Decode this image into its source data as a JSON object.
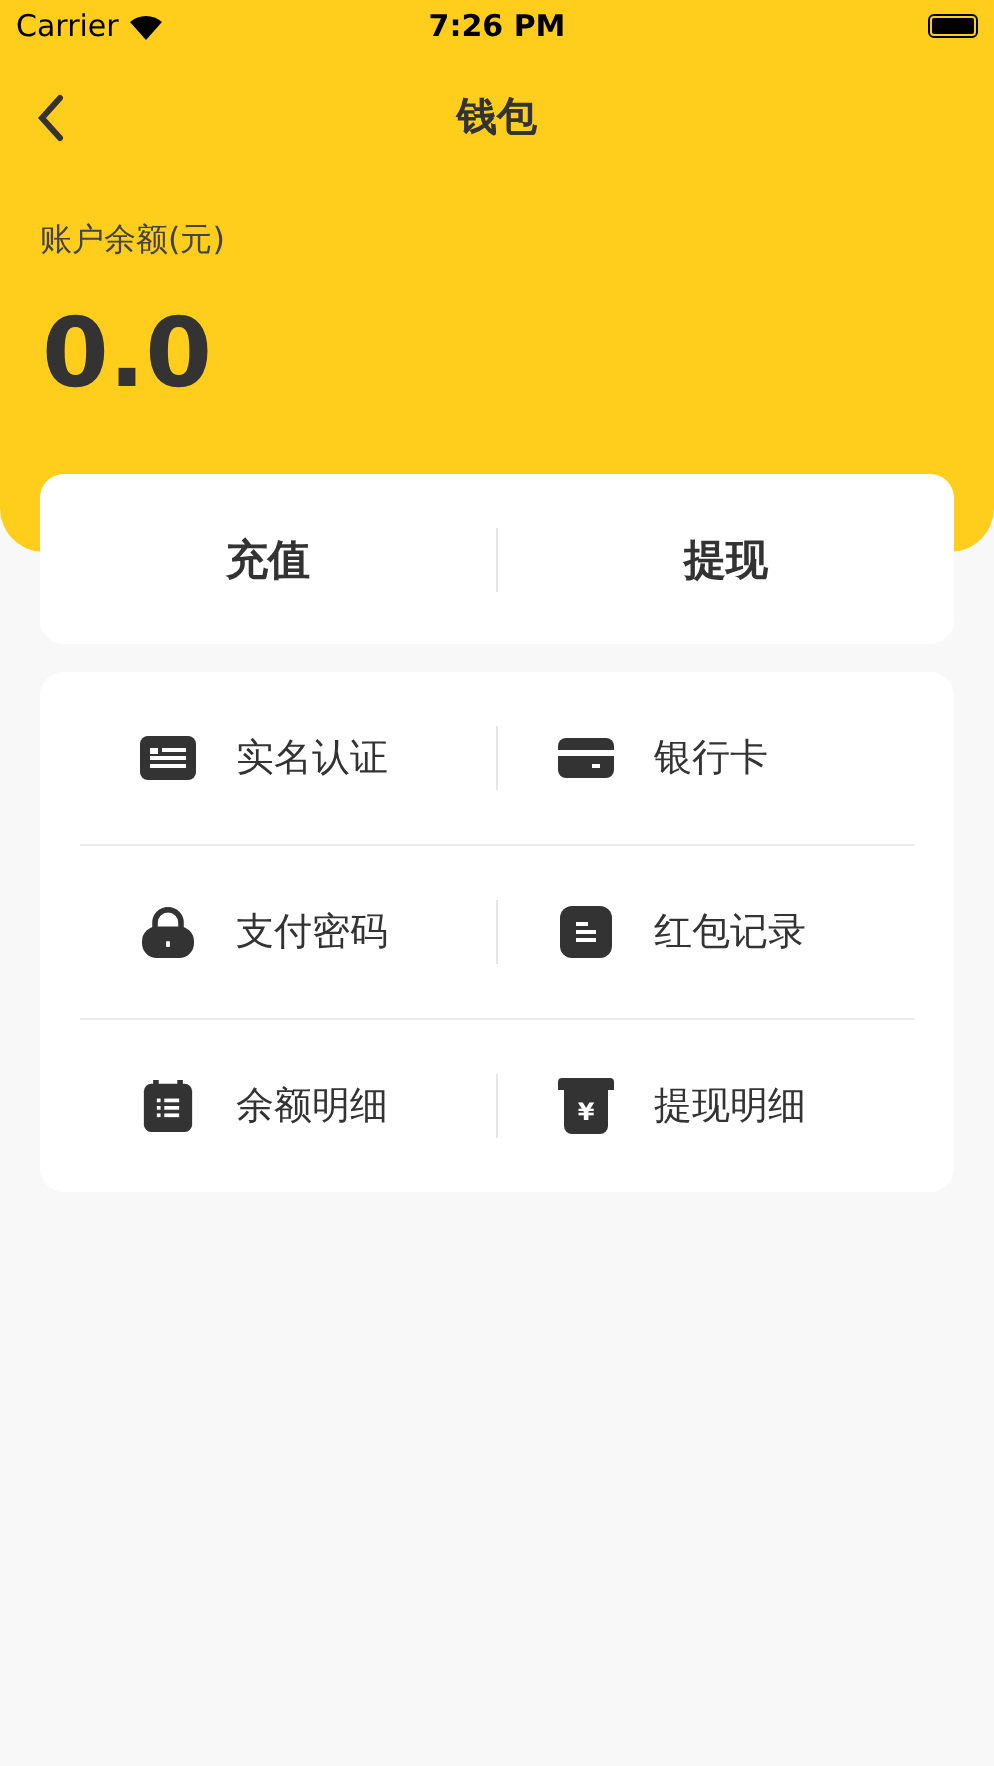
{
  "status_bar": {
    "carrier": "Carrier",
    "time": "7:26 PM"
  },
  "nav": {
    "title": "钱包"
  },
  "balance": {
    "label": "账户余额(元)",
    "amount": "0.0"
  },
  "actions": [
    "充值",
    "提现"
  ],
  "menu": [
    {
      "kind": "id-card",
      "label": "实名认证"
    },
    {
      "kind": "bank-card",
      "label": "银行卡"
    },
    {
      "kind": "lock",
      "label": "支付密码"
    },
    {
      "kind": "document",
      "label": "红包记录"
    },
    {
      "kind": "list",
      "label": "余额明细"
    },
    {
      "kind": "receipt",
      "label": "提现明细",
      "glyph": "¥"
    }
  ]
}
